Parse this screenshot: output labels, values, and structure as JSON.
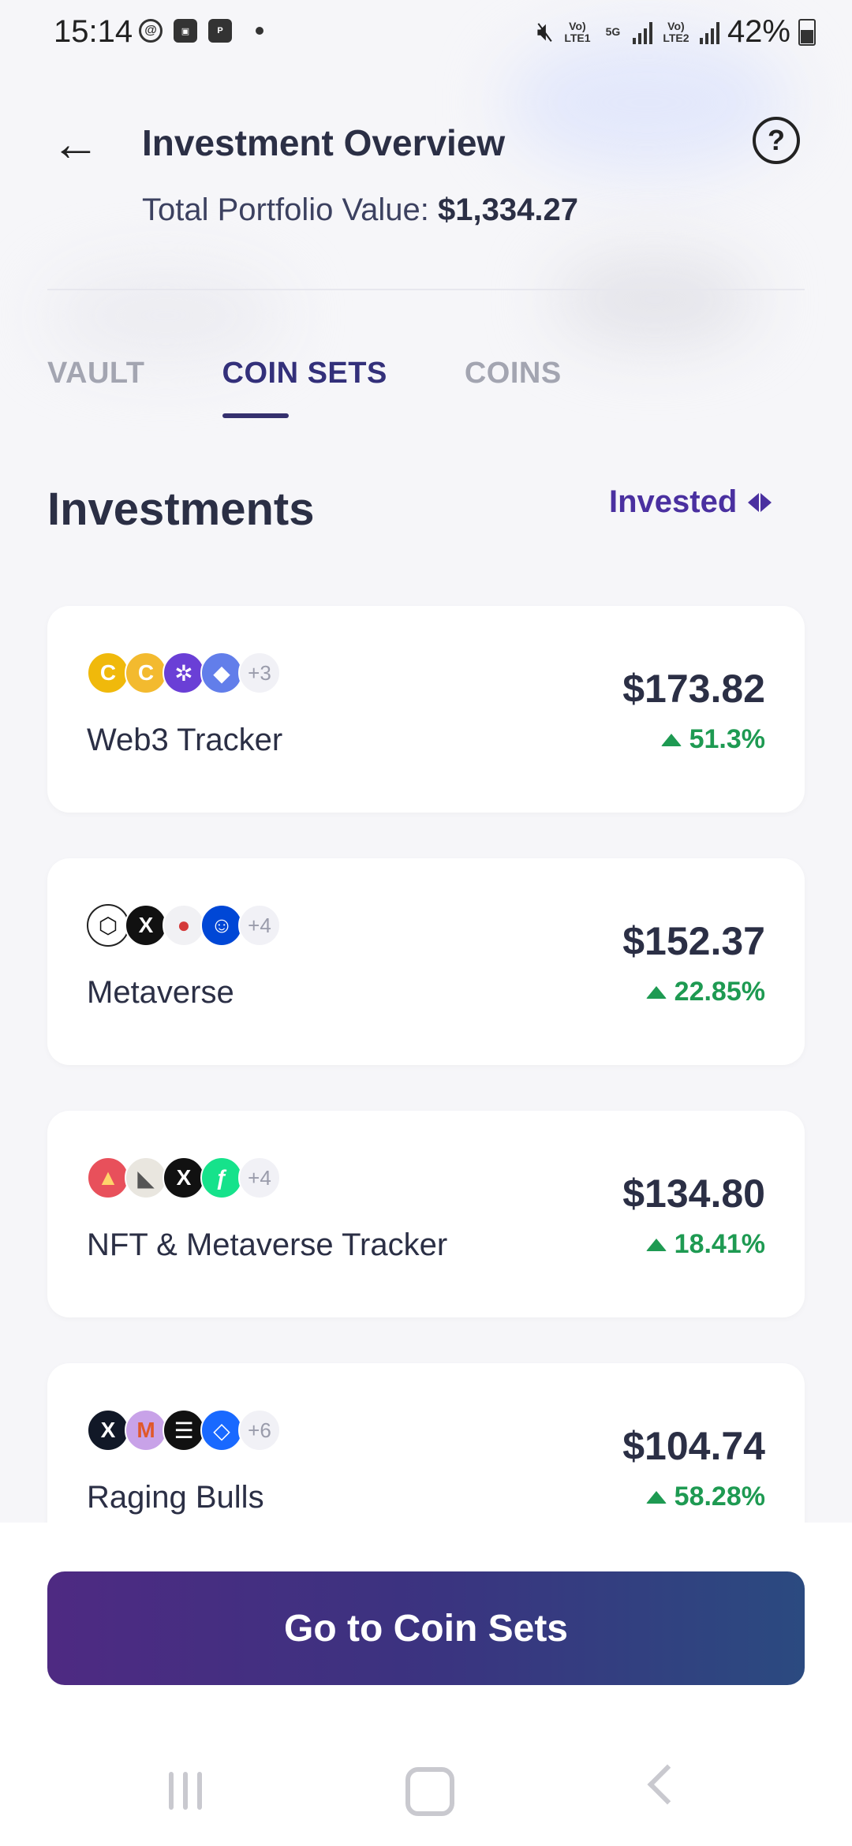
{
  "status_bar": {
    "time": "15:14",
    "battery": "42%",
    "sim1": "Vo) LTE1",
    "net": "5G",
    "sim2": "Vo) LTE2"
  },
  "header": {
    "title": "Investment Overview",
    "portfolio_label": "Total Portfolio Value:",
    "portfolio_value": "$1,334.27"
  },
  "tabs": [
    {
      "label": "VAULT",
      "active": false
    },
    {
      "label": "COIN SETS",
      "active": true
    },
    {
      "label": "COINS",
      "active": false
    }
  ],
  "section": {
    "title": "Investments",
    "sort_label": "Invested"
  },
  "cards": [
    {
      "name": "Web3 Tracker",
      "value": "$173.82",
      "change": "51.3%",
      "more": "+3",
      "coins": [
        {
          "icon": "coin-gold-icon",
          "glyph": "C",
          "bg": "#f0b90b",
          "fg": "#fff"
        },
        {
          "icon": "coin-gold-icon",
          "glyph": "C",
          "bg": "#f3ba2f",
          "fg": "#fff"
        },
        {
          "icon": "coin-purple-network-icon",
          "glyph": "✲",
          "bg": "#6a3fd6",
          "fg": "#fff"
        },
        {
          "icon": "ethereum-icon",
          "glyph": "◆",
          "bg": "#627eea",
          "fg": "#fff"
        }
      ]
    },
    {
      "name": "Metaverse",
      "value": "$152.37",
      "change": "22.85%",
      "more": "+4",
      "coins": [
        {
          "icon": "cube-coin-icon",
          "glyph": "⬡",
          "bg": "#ffffff",
          "fg": "#111"
        },
        {
          "icon": "x-coin-icon",
          "glyph": "X",
          "bg": "#111111",
          "fg": "#fff"
        },
        {
          "icon": "red-dot-coin-icon",
          "glyph": "●",
          "bg": "#f1f1f4",
          "fg": "#d43a3a"
        },
        {
          "icon": "ape-coin-icon",
          "glyph": "☺",
          "bg": "#0047d6",
          "fg": "#fff"
        }
      ]
    },
    {
      "name": "NFT & Metaverse Tracker",
      "value": "$134.80",
      "change": "18.41%",
      "more": "+4",
      "coins": [
        {
          "icon": "sandbox-coin-icon",
          "glyph": "▲",
          "bg": "#e8505b",
          "fg": "#ffd36b"
        },
        {
          "icon": "mountain-coin-icon",
          "glyph": "◣",
          "bg": "#e9e6df",
          "fg": "#555"
        },
        {
          "icon": "x-coin-icon",
          "glyph": "X",
          "bg": "#111111",
          "fg": "#fff"
        },
        {
          "icon": "flow-coin-icon",
          "glyph": "ƒ",
          "bg": "#16e28b",
          "fg": "#fff"
        }
      ]
    },
    {
      "name": "Raging Bulls",
      "value": "$104.74",
      "change": "58.28%",
      "more": "+6",
      "coins": [
        {
          "icon": "x-coin-icon",
          "glyph": "X",
          "bg": "#111827",
          "fg": "#fff"
        },
        {
          "icon": "wave-coin-icon",
          "glyph": "M",
          "bg": "#c8a2e8",
          "fg": "#e0582a"
        },
        {
          "icon": "stripes-coin-icon",
          "glyph": "☰",
          "bg": "#111111",
          "fg": "#fff"
        },
        {
          "icon": "fantom-coin-icon",
          "glyph": "◇",
          "bg": "#1969ff",
          "fg": "#fff"
        }
      ]
    }
  ],
  "cta": {
    "label": "Go to Coin Sets"
  },
  "colors": {
    "accent": "#4a30a0",
    "positive": "#1e9a52"
  }
}
